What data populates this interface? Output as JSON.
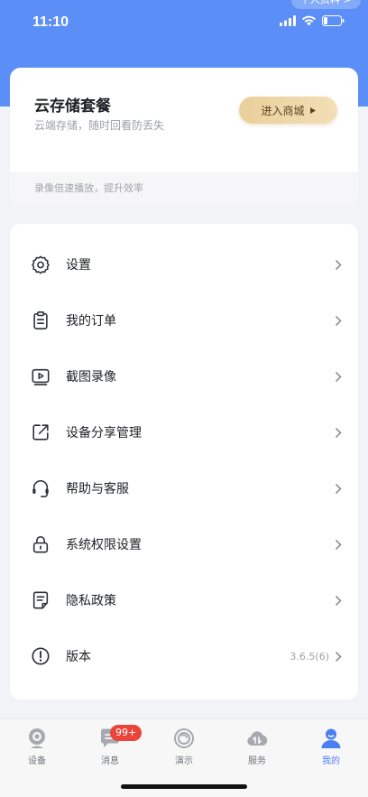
{
  "status_bar": {
    "time": "11:10"
  },
  "header": {
    "profile_link": "个人资料"
  },
  "cloud_card": {
    "title": "云存储套餐",
    "subtitle": "云端存储，随时回看防丢失",
    "mall_button": "进入商城",
    "note": "录像倍速播放，提升效率"
  },
  "menu": [
    {
      "label": "设置",
      "icon": "gear-icon"
    },
    {
      "label": "我的订单",
      "icon": "clipboard-icon"
    },
    {
      "label": "截图录像",
      "icon": "video-icon"
    },
    {
      "label": "设备分享管理",
      "icon": "share-icon"
    },
    {
      "label": "帮助与客服",
      "icon": "headset-icon"
    },
    {
      "label": "系统权限设置",
      "icon": "lock-icon"
    },
    {
      "label": "隐私政策",
      "icon": "document-icon"
    },
    {
      "label": "版本",
      "icon": "info-icon",
      "value": "3.6.5(6)"
    }
  ],
  "tabs": [
    {
      "label": "设备",
      "icon": "camera-icon"
    },
    {
      "label": "消息",
      "icon": "message-icon",
      "badge": "99+"
    },
    {
      "label": "演示",
      "icon": "demo-icon"
    },
    {
      "label": "服务",
      "icon": "cloud-service-icon"
    },
    {
      "label": "我的",
      "icon": "person-icon",
      "active": true
    }
  ],
  "colors": {
    "brand": "#5b8ff7",
    "active_tab": "#4b7ff2",
    "badge": "#e9453a"
  }
}
